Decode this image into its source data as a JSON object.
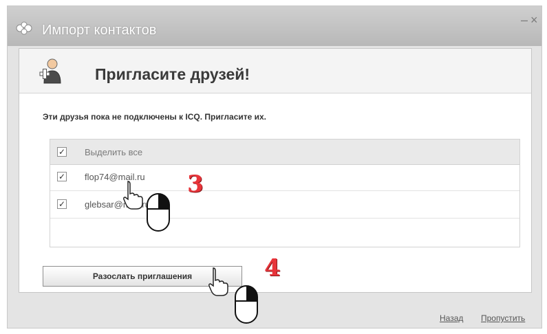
{
  "window": {
    "title": "Импорт контактов",
    "minimize_glyph": "–",
    "close_glyph": "×"
  },
  "header": {
    "heading": "Пригласите друзей!"
  },
  "notice": "Эти друзья пока не подключены к ICQ. Пригласите их.",
  "list": {
    "select_all_label": "Выделить все",
    "contacts": [
      {
        "email": "flop74@mail.ru",
        "checked": true
      },
      {
        "email": "glebsar@mail.ru",
        "checked": true
      }
    ]
  },
  "buttons": {
    "send_invites": "Разослать приглашения"
  },
  "footer": {
    "back": "Назад",
    "skip": "Пропустить"
  },
  "annotations": {
    "step3": "3",
    "step4": "4"
  },
  "icons": [
    "app-icon",
    "add-user-icon",
    "checkbox-checked-icon",
    "hand-cursor-icon",
    "mouse-icon"
  ],
  "colors": {
    "accent_badge": "#e8343a"
  }
}
